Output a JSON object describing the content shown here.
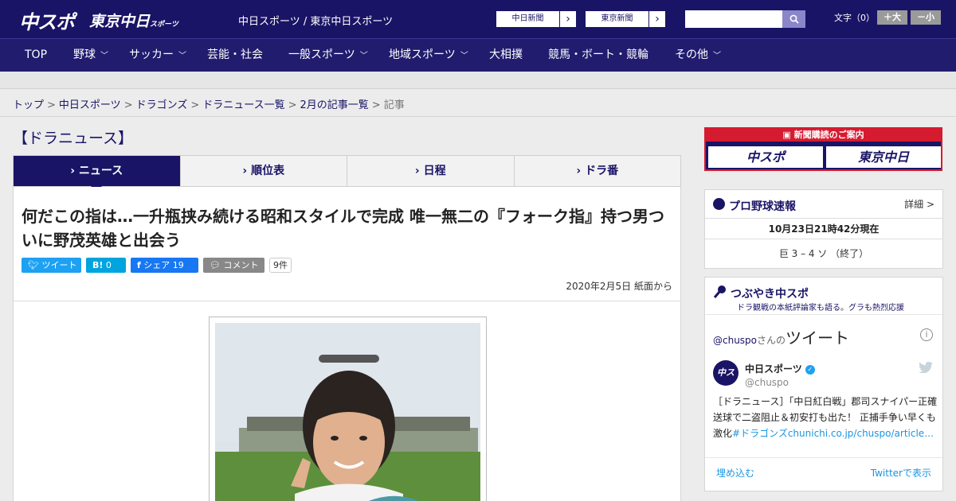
{
  "header": {
    "logo_chuspo": "中スポ",
    "logo_tokyo": "東京中日",
    "logo_tokyo_sub": "スポーツ",
    "site_names": "中日スポーツ / 東京中日スポーツ",
    "paper_buttons": [
      "中日新聞",
      "東京新聞"
    ],
    "arrow": "›",
    "search_placeholder": "",
    "text_size_label": "文字（0）",
    "text_size_up": "＋大",
    "text_size_down": "－小"
  },
  "nav": {
    "items": [
      {
        "label": "TOP",
        "has_dropdown": false
      },
      {
        "label": "野球",
        "has_dropdown": true
      },
      {
        "label": "サッカー",
        "has_dropdown": true
      },
      {
        "label": "芸能・社会",
        "has_dropdown": false
      },
      {
        "label": "一般スポーツ",
        "has_dropdown": true
      },
      {
        "label": "地域スポーツ",
        "has_dropdown": true
      },
      {
        "label": "大相撲",
        "has_dropdown": false
      },
      {
        "label": "競馬・ボート・競輪",
        "has_dropdown": false
      },
      {
        "label": "その他",
        "has_dropdown": true
      }
    ]
  },
  "breadcrumb": {
    "items": [
      "トップ",
      "中日スポーツ",
      "ドラゴンズ",
      "ドラニュース一覧",
      "2月の記事一覧"
    ],
    "current": "記事",
    "separator": ">"
  },
  "section_title": "【ドラニュース】",
  "tabs": [
    {
      "label": "ニュース",
      "active": true
    },
    {
      "label": "順位表",
      "active": false
    },
    {
      "label": "日程",
      "active": false
    },
    {
      "label": "ドラ番",
      "active": false
    }
  ],
  "tab_marker": "›",
  "article": {
    "title": "何だこの指は…一升瓶挟み続ける昭和スタイルで完成 唯一無二の『フォーク指』持つ男ついに野茂英雄と出会う",
    "share": {
      "tweet": "ツイート",
      "hatena_label": "B!",
      "hatena_count": "0",
      "facebook_label": "シェア",
      "facebook_count": "19",
      "comment_label": "コメント",
      "comment_count": "9件"
    },
    "date": "2020年2月5日 紙面から"
  },
  "sidebar": {
    "subscribe": {
      "heading": "新聞購読のご案内",
      "logo1": "中スポ",
      "logo2": "東京中日"
    },
    "score": {
      "title": "プロ野球速報",
      "detail": "詳細 >",
      "time": "10月23日21時42分現在",
      "game": "巨 3 – 4 ソ （終了）"
    },
    "tweets": {
      "title": "つぶやき中スポ",
      "subtitle": "ドラ観戦の本紙評論家も語る。グラも熱烈応援",
      "handle_prefix": "@chuspo",
      "handle_mid": "さんの",
      "handle_big": "ツイート",
      "info": "i",
      "user_name": "中日スポーツ",
      "user_handle": "@chuspo",
      "avatar_text": "中スポ",
      "verified": "✓",
      "text_main": "［ドラニュース］「中日紅白戦」郡司スナイパー正確送球で二盗阻止＆初安打も出た！ 正捕手争い早くも激化",
      "text_link": "#ドラゴンズchunichi.co.jp/chuspo/article…",
      "embed": "埋め込む",
      "view": "Twitterで表示"
    }
  },
  "colors": {
    "brand_navy": "#1a1466",
    "nav_bg": "#211c6e",
    "ad_red": "#d51b30",
    "twitter_blue": "#1da1f2",
    "facebook_blue": "#1877f2",
    "hatena_blue": "#00a4de"
  },
  "icons": [
    "search-icon",
    "twitter-bird-icon",
    "facebook-icon",
    "comment-icon",
    "baseball-icon",
    "microphone-icon",
    "info-icon",
    "verified-icon",
    "newspaper-icon"
  ]
}
